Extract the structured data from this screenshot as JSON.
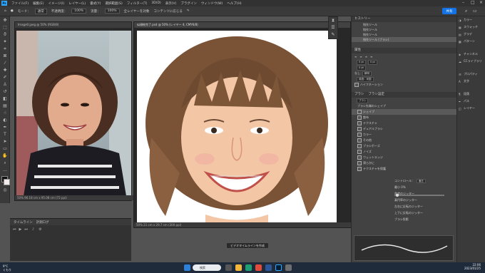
{
  "menubar": {
    "logo": "Ps",
    "items": [
      "ファイル(F)",
      "編集(E)",
      "イメージ(I)",
      "レイヤー(L)",
      "書式(Y)",
      "選択範囲(S)",
      "フィルター(T)",
      "3D(D)",
      "表示(V)",
      "プラグイン",
      "ウィンドウ(W)",
      "ヘルプ(H)"
    ]
  },
  "options": {
    "mode_label": "モード：",
    "mode_value": "通常",
    "opacity_label": "不透明度：",
    "opacity_value": "100%",
    "flow_label": "流量：",
    "flow_value": "100%",
    "sample_all": "全レイヤーを対象",
    "content_aware": "コンテンツに応じる",
    "share_label": "共有"
  },
  "doc1": {
    "tab": "Image0.jpeg @ 50% (RGB/8)",
    "status": "50%    96.18 cm x 95.08 cm (72 ppi)"
  },
  "doc2": {
    "tab": "似顔絵完了.psd @ 50% (レイヤー 4, CMYK/8)",
    "status": "50%    21 cm x 29.7 cm (300 ppi)"
  },
  "timeline": {
    "tab1": "タイムライン",
    "tab2": "計測ログ",
    "create_button": "ビデオタイムラインを作成"
  },
  "history": {
    "title": "ヒストリー",
    "items": [
      "指先ツール",
      "指先ツール",
      "指先ツール",
      "指先ツール (ブラシ)"
    ]
  },
  "properties": {
    "title": "属性",
    "tracking_label": "0 pt",
    "leading_label": "0 pt",
    "size_value": "0 pt",
    "aa_label": "鮮明",
    "language_label": "英語：米国",
    "hyphen_label": "ハイフネーション",
    "none_label": "なし"
  },
  "brush": {
    "tab1": "ブラシ",
    "tab2": "ブラシ設定",
    "brush_button": "ブラシ",
    "preset_label": "ブラシ先端のシェイプ",
    "rows": [
      "シェイプ",
      "散布",
      "テクスチャ",
      "デュアルブラシ",
      "カラー",
      "その他",
      "ブラシポーズ",
      "ノイズ",
      "ウェットエッジ",
      "滑らかに",
      "テクスチャを保護"
    ],
    "control_label": "コントロール：",
    "control_value": "筆圧",
    "min_label": "最小の直径",
    "jitter_label": "最小",
    "pct": "0%",
    "angle_label": "角度のジッター",
    "roundness_label": "真円率のジッター",
    "flip_x": "左右に反転のジッター",
    "flip_y": "上下に反転のジッター",
    "proj": "ブラシ投影"
  },
  "farright": {
    "items": [
      "カラー",
      "スウォッチ",
      "グラデ",
      "パターン",
      "チャンネル",
      "CCライブラリ",
      "プロパティ",
      "文字",
      "段落",
      "パス",
      "レイヤー"
    ]
  },
  "taskbar": {
    "temp": "9°C",
    "weather": "くもり",
    "search": "検索",
    "time": "22:06",
    "date": "2023/01/25"
  }
}
